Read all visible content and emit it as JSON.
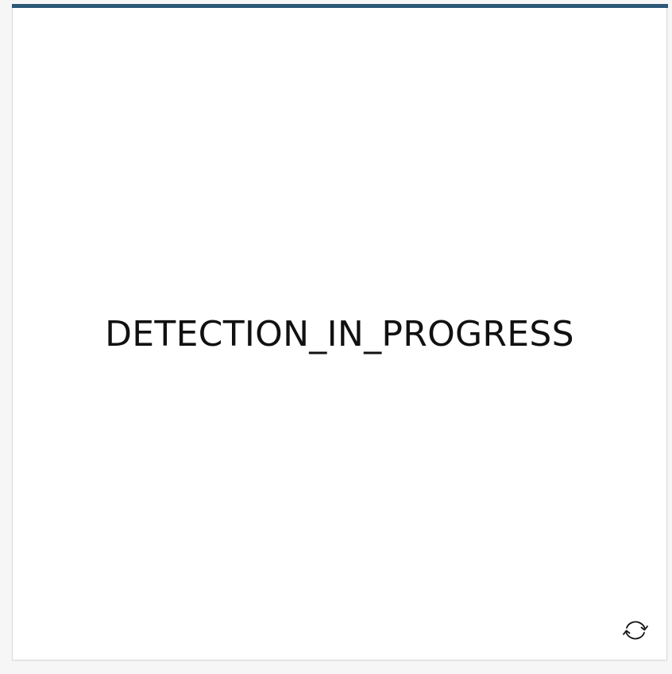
{
  "widget": {
    "status_text": "DETECTION_IN_PROGRESS",
    "accent_color": "#2c5777",
    "refresh_icon": "refresh-icon"
  }
}
